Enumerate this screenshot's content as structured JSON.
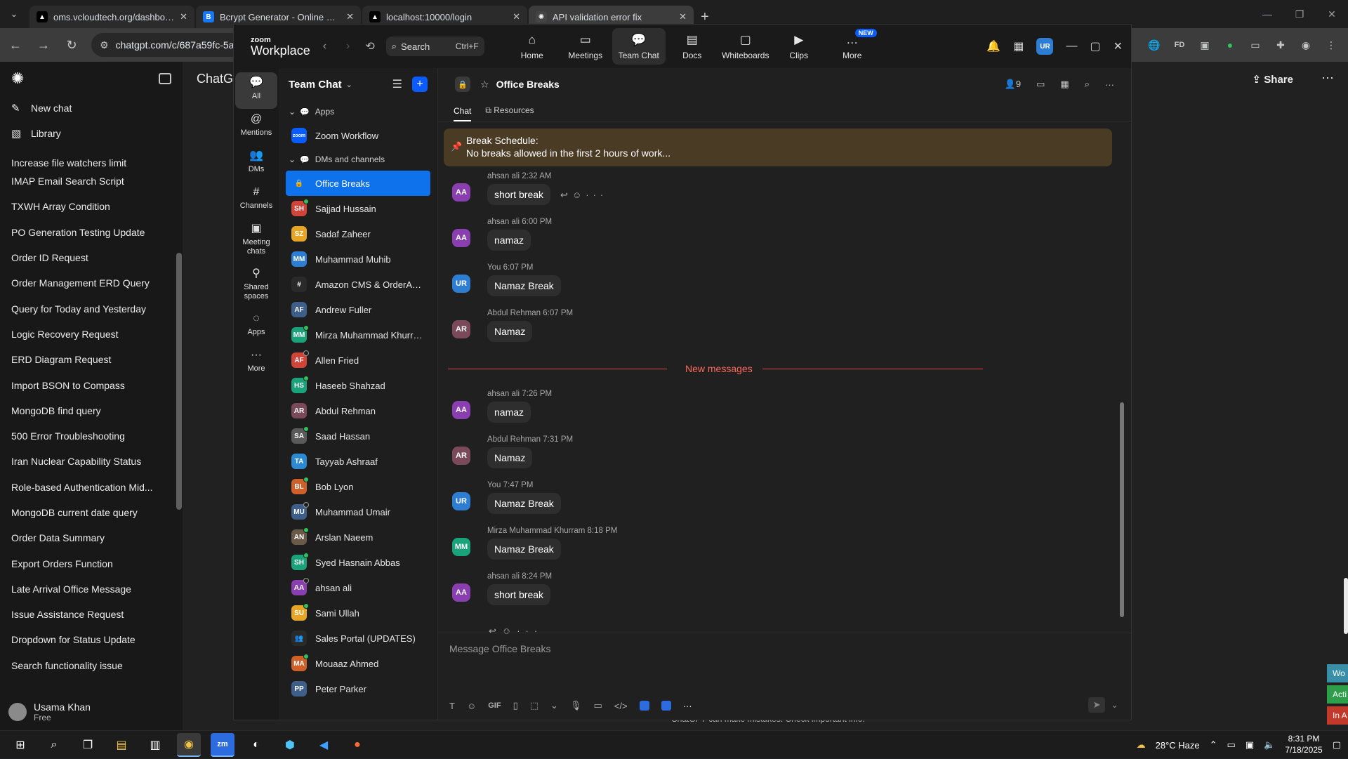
{
  "browser": {
    "tabs": [
      {
        "title": "oms.vcloudtech.org/dashboard",
        "icon": "triangle-icon",
        "active": false
      },
      {
        "title": "Bcrypt Generator - Online Hash",
        "icon": "bcrypt-b-icon",
        "active": false
      },
      {
        "title": "localhost:10000/login",
        "icon": "triangle-icon",
        "active": false
      },
      {
        "title": "API validation error fix",
        "icon": "openai-icon",
        "active": true
      }
    ],
    "address": "chatgpt.com/c/687a59fc-5a",
    "tab_close": "✕",
    "new_tab": "+"
  },
  "chatgpt": {
    "new_chat": "New chat",
    "library": "Library",
    "title": "ChatG",
    "share": "Share",
    "history": [
      "Increase file watchers limit",
      "IMAP Email Search Script",
      "TXWH Array Condition",
      "PO Generation Testing Update",
      "Order ID Request",
      "Order Management ERD Query",
      "Query for Today and Yesterday",
      "Logic Recovery Request",
      "ERD Diagram Request",
      "Import BSON to Compass",
      "MongoDB find query",
      "500 Error Troubleshooting",
      "Iran Nuclear Capability Status",
      "Role-based Authentication Mid...",
      "MongoDB current date query",
      "Order Data Summary",
      "Export Orders Function",
      "Late Arrival Office Message",
      "Issue Assistance Request",
      "Dropdown for Status Update",
      "Search functionality issue"
    ],
    "user_name": "Usama Khan",
    "user_plan": "Free",
    "footer": "ChatGPT can make mistakes. Check important info.",
    "side_tabs": [
      "Wo",
      "Acti",
      "In A"
    ]
  },
  "zoom": {
    "logo_top": "zoom",
    "logo_bottom": "Workplace",
    "search_label": "Search",
    "search_shortcut": "Ctrl+F",
    "nav_tabs": [
      {
        "label": "Home",
        "icon": "⌂"
      },
      {
        "label": "Meetings",
        "icon": "▭"
      },
      {
        "label": "Team Chat",
        "icon": "💬"
      },
      {
        "label": "Docs",
        "icon": "▤"
      },
      {
        "label": "Whiteboards",
        "icon": "▢"
      },
      {
        "label": "Clips",
        "icon": "▶"
      },
      {
        "label": "More",
        "icon": "…",
        "badge": "NEW"
      }
    ],
    "user_initials": "UR",
    "rail": [
      {
        "label": "All",
        "icon": "💬"
      },
      {
        "label": "Mentions",
        "icon": "@"
      },
      {
        "label": "DMs",
        "icon": "👥"
      },
      {
        "label": "Channels",
        "icon": "#"
      },
      {
        "label": "Meeting chats",
        "icon": "▣"
      },
      {
        "label": "Shared spaces",
        "icon": "⚲"
      },
      {
        "label": "Apps",
        "icon": "◌"
      },
      {
        "label": "More",
        "icon": "···"
      }
    ],
    "list_title": "Team Chat",
    "section_apps": "Apps",
    "app_item": "Zoom Workflow",
    "section_dms": "DMs and channels",
    "contacts": [
      {
        "name": "Office Breaks",
        "initials": "🔒",
        "color": "#0e72ed",
        "selected": true,
        "status": ""
      },
      {
        "name": "Sajjad Hussain",
        "initials": "SH",
        "color": "#d0443a",
        "status": "on"
      },
      {
        "name": "Sadaf Zaheer",
        "initials": "SZ",
        "color": "#e7a526",
        "status": ""
      },
      {
        "name": "Muhammad Muhib",
        "initials": "MM",
        "color": "#2d7dd2",
        "status": ""
      },
      {
        "name": "Amazon CMS & OrderAuto...",
        "initials": "#",
        "color": "#2a2a2a",
        "status": ""
      },
      {
        "name": "Andrew Fuller",
        "initials": "AF",
        "color": "#3e5f8a",
        "status": ""
      },
      {
        "name": "Mirza Muhammad Khurram",
        "initials": "MM",
        "color": "#1aa37a",
        "status": "on"
      },
      {
        "name": "Allen Fried",
        "initials": "AF",
        "color": "#d0443a",
        "status": "off"
      },
      {
        "name": "Haseeb Shahzad",
        "initials": "HS",
        "color": "#1aa37a",
        "status": "on"
      },
      {
        "name": "Abdul Rehman",
        "initials": "AR",
        "color": "#7a4a5a",
        "status": ""
      },
      {
        "name": "Saad Hassan",
        "initials": "SA",
        "color": "#5a5a5a",
        "status": "on"
      },
      {
        "name": "Tayyab Ashraaf",
        "initials": "TA",
        "color": "#2d8ad2",
        "status": ""
      },
      {
        "name": "Bob Lyon",
        "initials": "BL",
        "color": "#d0602a",
        "status": "on"
      },
      {
        "name": "Muhammad Umair",
        "initials": "MU",
        "color": "#3e5f8a",
        "status": "off"
      },
      {
        "name": "Arslan Naeem",
        "initials": "AN",
        "color": "#6a5a4a",
        "status": "on"
      },
      {
        "name": "Syed Hasnain Abbas",
        "initials": "SH",
        "color": "#1aa37a",
        "status": "on"
      },
      {
        "name": "ahsan ali",
        "initials": "AA",
        "color": "#8a3fb0",
        "status": "off"
      },
      {
        "name": "Sami Ullah",
        "initials": "SU",
        "color": "#e7a526",
        "status": "on"
      },
      {
        "name": "Sales Portal (UPDATES)",
        "initials": "👥",
        "color": "#2a2a2a",
        "status": ""
      },
      {
        "name": "Mouaaz Ahmed",
        "initials": "MA",
        "color": "#d0602a",
        "status": "on"
      },
      {
        "name": "Peter Parker",
        "initials": "PP",
        "color": "#3e5f8a",
        "status": ""
      }
    ],
    "channel_title": "Office Breaks",
    "member_count": "9",
    "subtab_chat": "Chat",
    "subtab_resources": "Resources",
    "pinned_title": "Break Schedule:",
    "pinned_body": "No breaks allowed in the first 2 hours of work...",
    "messages_before": [
      {
        "sender": "ahsan ali",
        "time": "2:32 AM",
        "text": "short break",
        "initials": "AA",
        "color": "#8a3fb0",
        "hover": true
      },
      {
        "sender": "ahsan ali",
        "time": "6:00 PM",
        "text": "namaz",
        "initials": "AA",
        "color": "#8a3fb0"
      },
      {
        "sender": "You",
        "time": "6:07 PM",
        "text": "Namaz Break",
        "initials": "UR",
        "color": "#2d7dd2"
      },
      {
        "sender": "Abdul Rehman",
        "time": "6:07 PM",
        "text": "Namaz",
        "initials": "AR",
        "color": "#7a4a5a"
      }
    ],
    "new_messages": "New messages",
    "messages_after": [
      {
        "sender": "ahsan ali",
        "time": "7:26 PM",
        "text": "namaz",
        "initials": "AA",
        "color": "#8a3fb0"
      },
      {
        "sender": "Abdul Rehman",
        "time": "7:31 PM",
        "text": "Namaz",
        "initials": "AR",
        "color": "#7a4a5a"
      },
      {
        "sender": "You",
        "time": "7:47 PM",
        "text": "Namaz Break",
        "initials": "UR",
        "color": "#2d7dd2"
      },
      {
        "sender": "Mirza Muhammad Khurram",
        "time": "8:18 PM",
        "text": "Namaz Break",
        "initials": "MM",
        "color": "#1aa37a"
      },
      {
        "sender": "ahsan ali",
        "time": "8:24 PM",
        "text": "short break",
        "initials": "AA",
        "color": "#8a3fb0"
      }
    ],
    "compose_placeholder": "Message Office Breaks",
    "gif_label": "GIF"
  },
  "taskbar": {
    "weather": "28°C  Haze",
    "time": "8:31 PM",
    "date": "7/18/2025"
  }
}
